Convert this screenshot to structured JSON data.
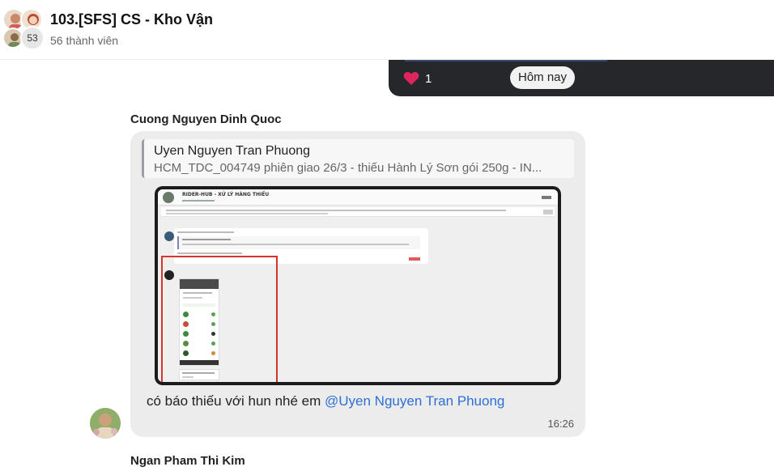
{
  "header": {
    "title": "103.[SFS] CS - Kho Vận",
    "member_count_badge": "53",
    "subtitle": "56 thành viên"
  },
  "previous_message": {
    "reaction_count": "1",
    "date_pill": "Hôm nay"
  },
  "message": {
    "sender": "Cuong Nguyen Dinh Quoc",
    "quote_author": "Uyen Nguyen Tran Phuong",
    "quote_text": "HCM_TDC_004749 phiên giao 26/3 - thiếu Hành Lý Sơn gói 250g - IN...",
    "text": "có báo thiếu với hun nhé em ",
    "mention": "@Uyen Nguyen Tran Phuong",
    "time": "16:26"
  },
  "screenshot": {
    "header_title": "RIDER-HUB - XỬ LÝ HÀNG THIẾU"
  },
  "next_message": {
    "sender": "Ngan Pham Thi Kim"
  },
  "colors": {
    "mention": "#2e6fd6",
    "dark_bubble": "#25272b",
    "bubble": "#ececec",
    "highlight_box": "#d8332a",
    "heart": "#e0245e"
  }
}
